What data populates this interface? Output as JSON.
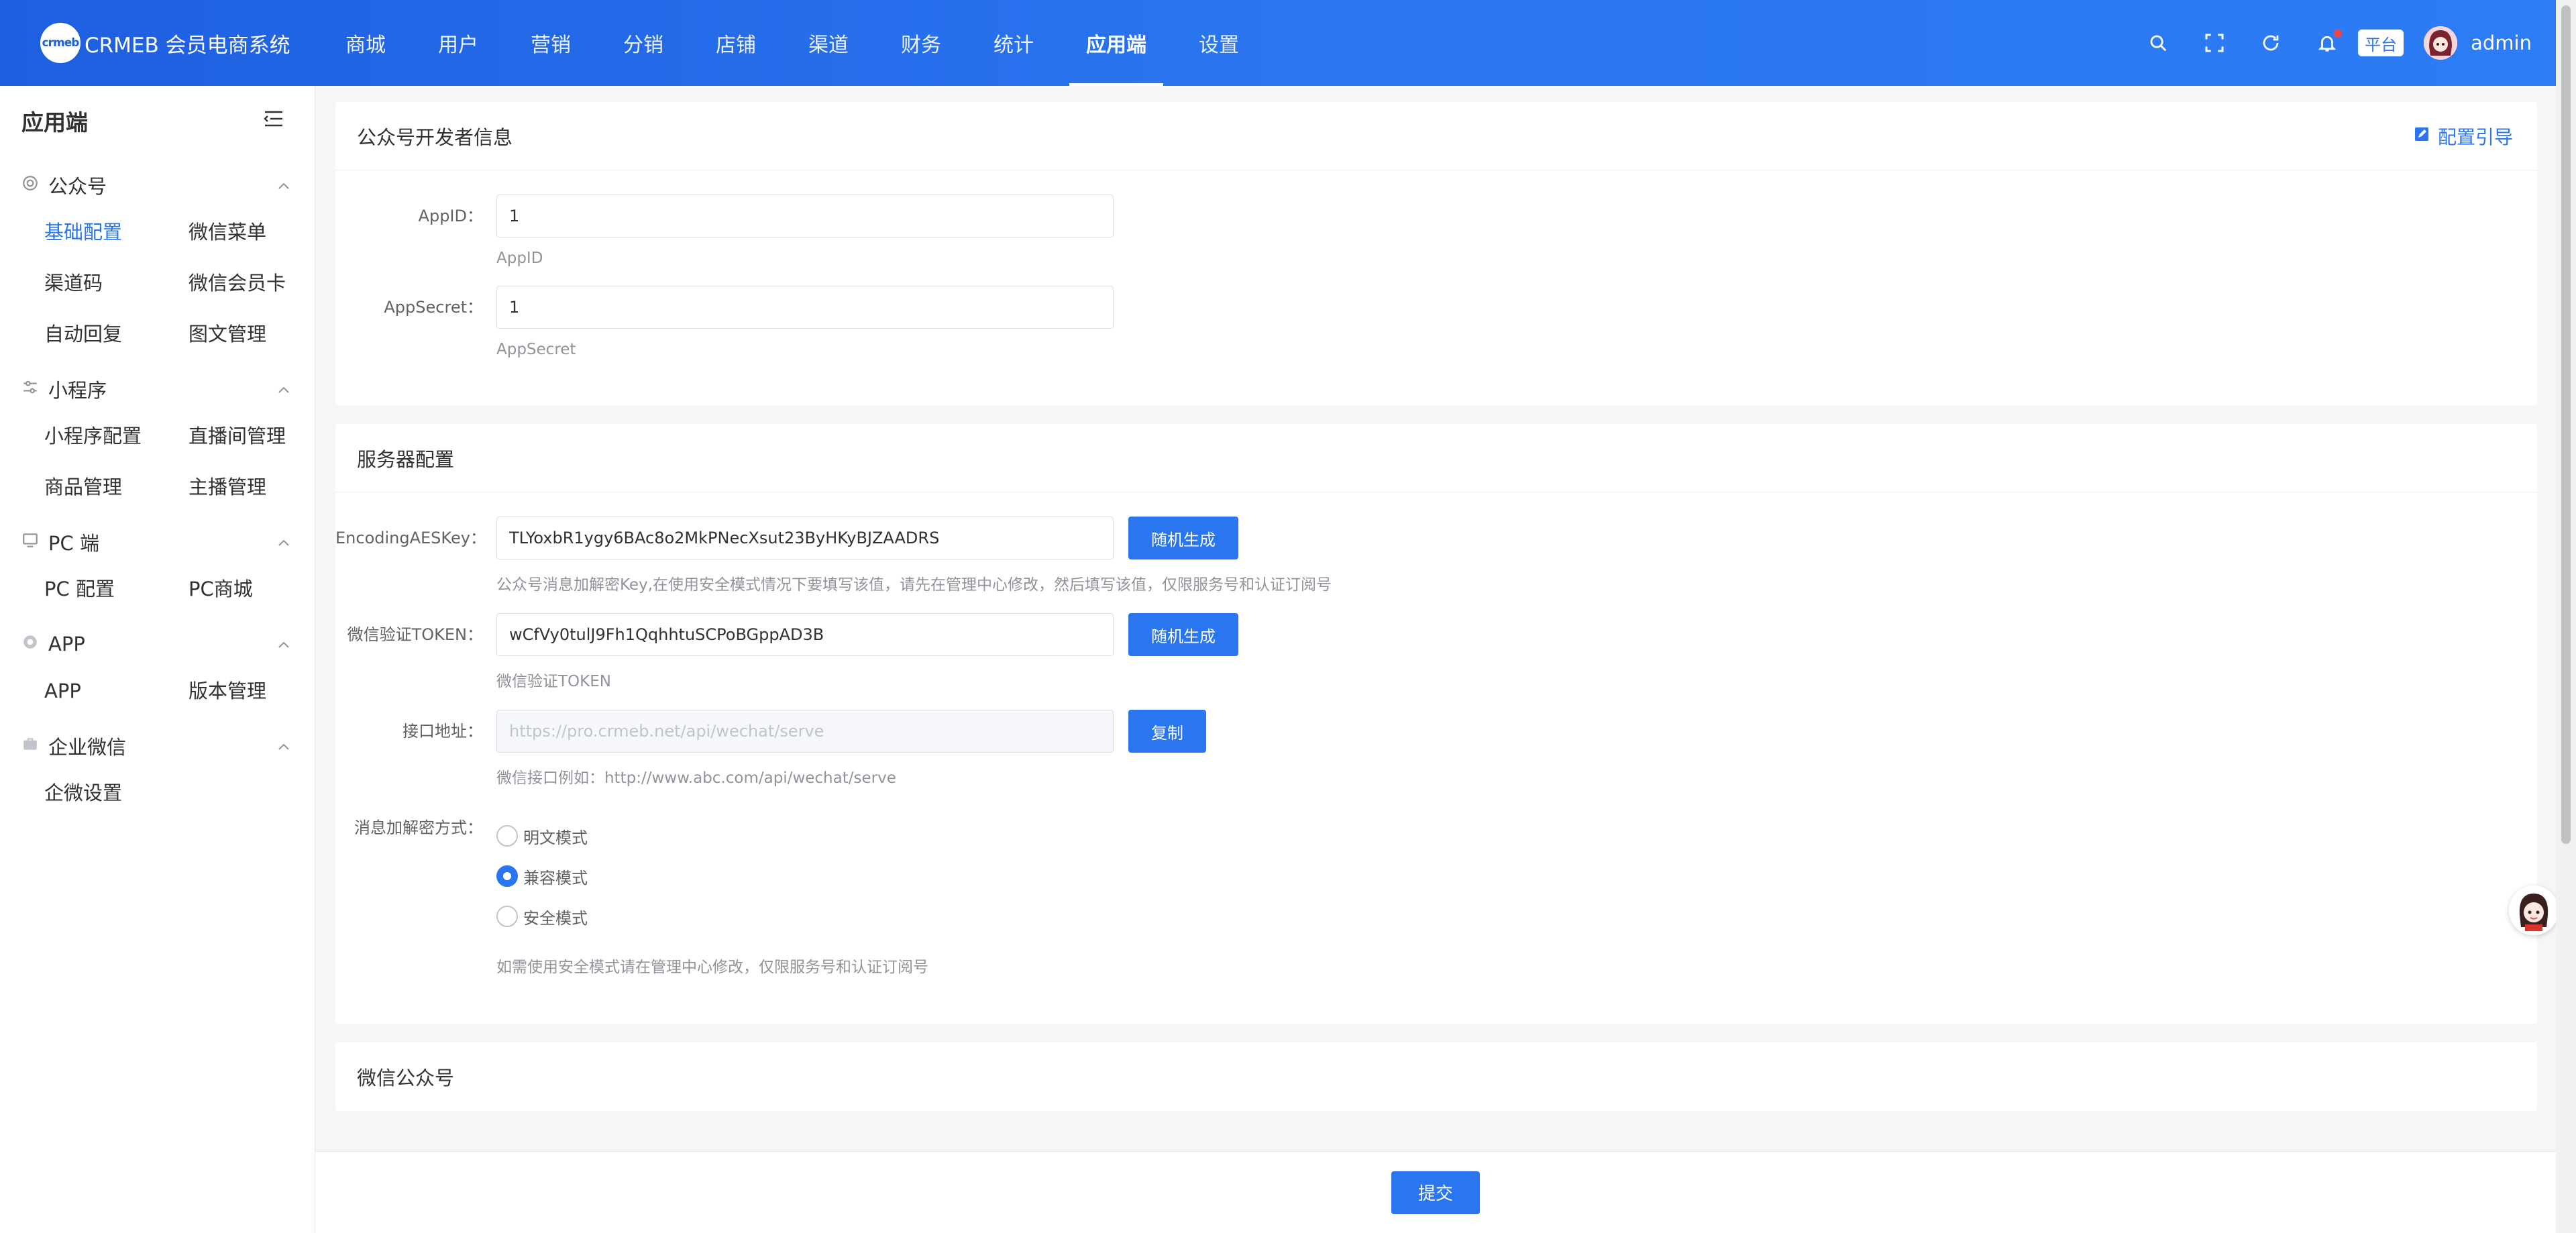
{
  "brand": {
    "logo_text": "crmeb",
    "name": "CRMEB 会员电商系统"
  },
  "top_nav": [
    {
      "label": "商城",
      "active": false
    },
    {
      "label": "用户",
      "active": false
    },
    {
      "label": "营销",
      "active": false
    },
    {
      "label": "分销",
      "active": false
    },
    {
      "label": "店铺",
      "active": false
    },
    {
      "label": "渠道",
      "active": false
    },
    {
      "label": "财务",
      "active": false
    },
    {
      "label": "统计",
      "active": false
    },
    {
      "label": "应用端",
      "active": true
    },
    {
      "label": "设置",
      "active": false
    }
  ],
  "top_right": {
    "platform_badge": "平台",
    "username": "admin"
  },
  "sidebar": {
    "title": "应用端",
    "groups": [
      {
        "label": "公众号",
        "icon": "wechat-official-icon",
        "items": [
          "基础配置",
          "微信菜单",
          "渠道码",
          "微信会员卡",
          "自动回复",
          "图文管理"
        ]
      },
      {
        "label": "小程序",
        "icon": "mini-program-icon",
        "items": [
          "小程序配置",
          "直播间管理",
          "商品管理",
          "主播管理"
        ]
      },
      {
        "label": "PC 端",
        "icon": "monitor-icon",
        "items": [
          "PC 配置",
          "PC商城"
        ]
      },
      {
        "label": "APP",
        "icon": "app-icon",
        "items": [
          "APP",
          "版本管理"
        ]
      },
      {
        "label": "企业微信",
        "icon": "briefcase-icon",
        "items": [
          "企微设置"
        ]
      }
    ],
    "active_item": "基础配置"
  },
  "dev_card": {
    "title": "公众号开发者信息",
    "guide_label": "配置引导",
    "appid": {
      "label": "AppID：",
      "value": "1",
      "help": "AppID"
    },
    "appsecret": {
      "label": "AppSecret：",
      "value": "1",
      "help": "AppSecret"
    }
  },
  "server_card": {
    "title": "服务器配置",
    "aeskey": {
      "label": "EncodingAESKey：",
      "value": "TLYoxbR1ygy6BAc8o2MkPNecXsut23ByHKyBJZAADRS",
      "button": "随机生成",
      "help": "公众号消息加解密Key,在使用安全模式情况下要填写该值，请先在管理中心修改，然后填写该值，仅限服务号和认证订阅号"
    },
    "token": {
      "label": "微信验证TOKEN：",
      "value": "wCfVy0tulJ9Fh1QqhhtuSCPoBGppAD3B",
      "button": "随机生成",
      "help": "微信验证TOKEN"
    },
    "endpoint": {
      "label": "接口地址：",
      "value": "https://pro.crmeb.net/api/wechat/serve",
      "button": "复制",
      "help": "微信接口例如：http://www.abc.com/api/wechat/serve"
    },
    "encrypt_mode": {
      "label": "消息加解密方式：",
      "options": [
        "明文模式",
        "兼容模式",
        "安全模式"
      ],
      "selected": "兼容模式",
      "help": "如需使用安全模式请在管理中心修改，仅限服务号和认证订阅号"
    }
  },
  "wechat_card": {
    "title": "微信公众号"
  },
  "footer": {
    "submit_label": "提交"
  },
  "colors": {
    "primary": "#2a75f0",
    "header_start": "#1e5fe0",
    "header_end": "#2c7cf5"
  }
}
